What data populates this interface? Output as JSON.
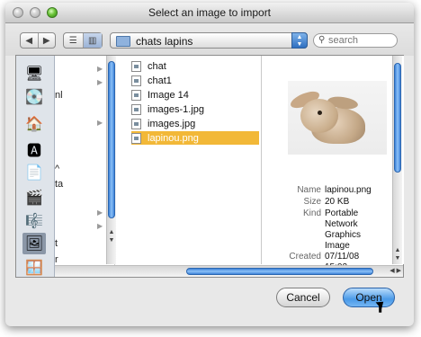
{
  "window": {
    "title": "Select an image to import"
  },
  "toolbar": {
    "back_icon": "back-arrow-icon",
    "forward_icon": "forward-arrow-icon",
    "view_list_icon": "list-view-icon",
    "view_column_icon": "column-view-icon",
    "location": "chats lapins",
    "search_placeholder": "search"
  },
  "sidebar": {
    "items": [
      {
        "icon": "computer-icon"
      },
      {
        "icon": "hard-disk-icon"
      },
      {
        "icon": "home-icon"
      },
      {
        "icon": "applications-icon"
      },
      {
        "icon": "documents-icon"
      },
      {
        "icon": "movies-icon"
      },
      {
        "icon": "music-icon"
      },
      {
        "icon": "pictures-icon",
        "selected": true
      },
      {
        "icon": "window-icon"
      }
    ]
  },
  "column1": {
    "fragments": [
      "nl",
      "^",
      "ta",
      "t",
      "r"
    ]
  },
  "files": [
    {
      "name": "chat",
      "selected": false
    },
    {
      "name": "chat1",
      "selected": false
    },
    {
      "name": "Image 14",
      "selected": false
    },
    {
      "name": "images-1.jpg",
      "selected": false
    },
    {
      "name": "images.jpg",
      "selected": false
    },
    {
      "name": "lapinou.png",
      "selected": true
    }
  ],
  "preview": {
    "image_icon": "rabbit-photo",
    "name_label": "Name",
    "name_value": "lapinou.png",
    "size_label": "Size",
    "size_value": "20 KB",
    "kind_label": "Kind",
    "kind_value": "Portable Network Graphics Image",
    "created_label": "Created",
    "created_value": "07/11/08 15:02"
  },
  "buttons": {
    "cancel": "Cancel",
    "open": "Open"
  },
  "colors": {
    "selection": "#f2b838",
    "accent_blue": "#3c82d8"
  }
}
